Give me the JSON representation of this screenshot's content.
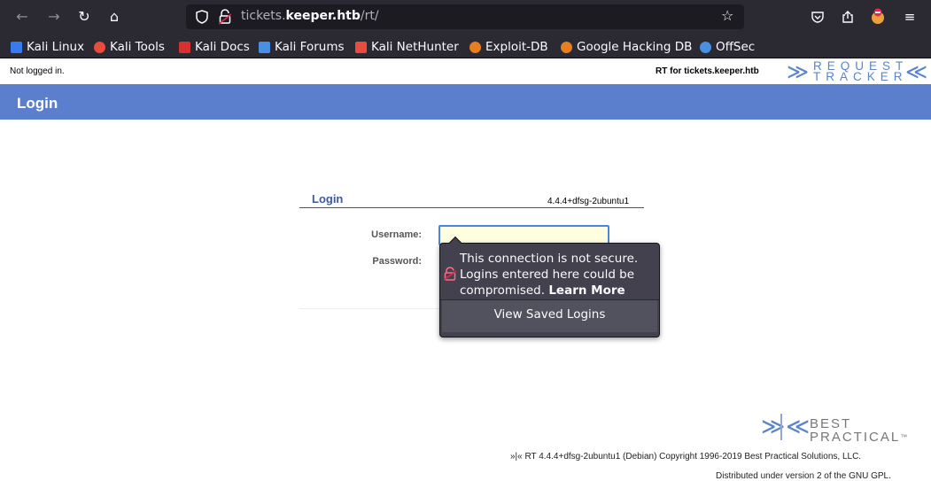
{
  "browser": {
    "url_host_prefix": "tickets.",
    "url_host_bold": "keeper.htb",
    "url_path": "/rt/",
    "bookmarks": [
      {
        "label": "Kali Linux",
        "icon": "kali-icon",
        "color": "#367bf0"
      },
      {
        "label": "Kali Tools",
        "icon": "kali-tools-icon",
        "color": "#e74c3c"
      },
      {
        "label": "Kali Docs",
        "icon": "kali-docs-icon",
        "color": "#d63031"
      },
      {
        "label": "Kali Forums",
        "icon": "kali-forums-icon",
        "color": "#4a90e2"
      },
      {
        "label": "Kali NetHunter",
        "icon": "nethunter-icon",
        "color": "#e74c3c"
      },
      {
        "label": "Exploit-DB",
        "icon": "exploit-db-icon",
        "color": "#e67e22"
      },
      {
        "label": "Google Hacking DB",
        "icon": "ghdb-icon",
        "color": "#e67e22"
      },
      {
        "label": "OffSec",
        "icon": "offsec-icon",
        "color": "#4a90e2"
      }
    ]
  },
  "header": {
    "not_logged_in": "Not logged in.",
    "rt_for": "RT for tickets.keeper.htb",
    "logo_line1": "REQUEST",
    "logo_line2": "TRACKER",
    "title": "Login"
  },
  "login": {
    "box_title": "Login",
    "version": "4.4.4+dfsg-2ubuntu1",
    "username_label": "Username:",
    "password_label": "Password:",
    "username_value": ""
  },
  "popup": {
    "message": "This connection is not secure. Logins entered here could be compromised.",
    "learn_more": "Learn More",
    "view_saved": "View Saved Logins"
  },
  "footer": {
    "bp_line1": "BEST",
    "bp_line2": "PRACTICAL",
    "bp_tm": "™",
    "copyright": "»|« RT 4.4.4+dfsg-2ubuntu1 (Debian) Copyright 1996-2019 Best Practical Solutions, LLC.",
    "distributed": "Distributed under version 2 of the GNU GPL."
  },
  "colors": {
    "accent": "#5b7fcc",
    "browser_bg": "#2b2a33",
    "popup_bg": "#42414d"
  }
}
